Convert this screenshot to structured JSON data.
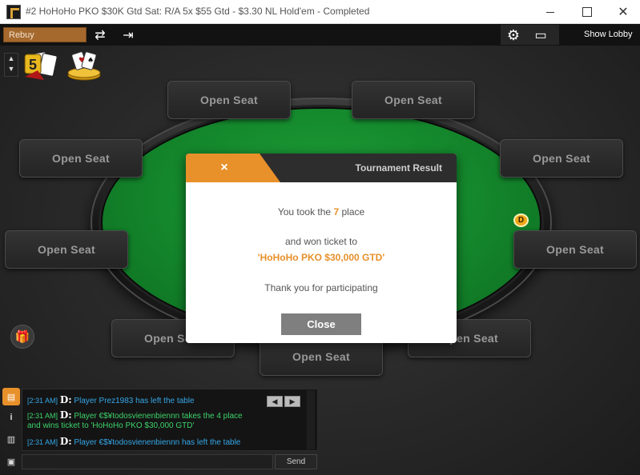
{
  "window": {
    "title": "#2 HoHoHo PKO $30K Gtd Sat: R/A 5x $55 Gtd - $3.30 NL Hold'em - Completed",
    "minimize_icon": "minimize-icon",
    "maximize_icon": "maximize-icon",
    "close_glyph": "✕"
  },
  "toolbar": {
    "rebuy_label": "Rebuy",
    "refresh_glyph": "⇄",
    "exit_glyph": "⇥",
    "settings_glyph": "⚙",
    "layout_glyph": "▭",
    "show_lobby_label": "Show Lobby"
  },
  "sidebar": {
    "up_glyph": "▲",
    "down_glyph": "▼",
    "promo_badge": "5",
    "gift_glyph": "🎁"
  },
  "seats": [
    {
      "label": "Open Seat"
    },
    {
      "label": "Open Seat"
    },
    {
      "label": "Open Seat"
    },
    {
      "label": "Open Seat"
    },
    {
      "label": "Open Seat"
    },
    {
      "label": "Open Seat"
    },
    {
      "label": "Open Seat"
    },
    {
      "label": "Open Seat"
    },
    {
      "label": "Open Seat"
    }
  ],
  "dealer_button": "D",
  "modal": {
    "close_glyph": "×",
    "title": "Tournament Result",
    "place_prefix": "You took the ",
    "place_number": "7",
    "place_suffix": " place",
    "won_text": "and won ticket to",
    "ticket_name": "'HoHoHo PKO $30,000 GTD'",
    "thanks_text": "Thank you for participating",
    "close_label": "Close",
    "accent_color": "#e8902a"
  },
  "chat": {
    "tabs": [
      {
        "icon": "chat-icon",
        "glyph": "▤"
      },
      {
        "icon": "info-icon",
        "glyph": "i"
      },
      {
        "icon": "stats-icon",
        "glyph": "▥"
      },
      {
        "icon": "notes-icon",
        "glyph": "▣"
      }
    ],
    "prev_glyph": "◀",
    "next_glyph": "▶",
    "lines": [
      {
        "time": "[2:31 AM]",
        "logo": "D:",
        "text": " Player Prez1983  has left the table"
      },
      {
        "time": "[2:31 AM]",
        "logo": "D:",
        "text": " Player €$¥todosvienenbiennn  takes the 4 place"
      },
      {
        "time": "",
        "logo": "",
        "text": "and wins ticket to 'HoHoHo PKO $30,000 GTD'"
      },
      {
        "time": "[2:31 AM]",
        "logo": "D:",
        "text": " Player €$¥todosvienenbiennn  has left the table"
      }
    ],
    "input_value": "",
    "send_label": "Send"
  }
}
